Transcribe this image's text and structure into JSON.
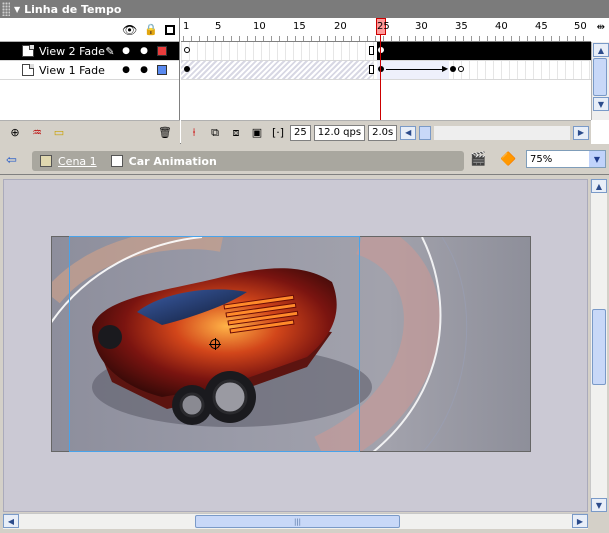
{
  "panel": {
    "title": "Linha de Tempo"
  },
  "layers": [
    {
      "name": "View 2 Fade",
      "selected": true,
      "color": "#e83c3c"
    },
    {
      "name": "View 1 Fade",
      "selected": false,
      "color": "#5a8af0"
    }
  ],
  "ruler": {
    "marks": [
      "1",
      "5",
      "10",
      "15",
      "20",
      "25",
      "30",
      "35",
      "40",
      "45",
      "50"
    ]
  },
  "status": {
    "current_frame": "25",
    "fps": "12.0 qps",
    "elapsed": "2.0s"
  },
  "editbar": {
    "scene": "Cena 1",
    "symbol": "Car Animation",
    "zoom": "75%"
  },
  "colors": {
    "header_bg": "#7b7b7b",
    "playhead": "#cc0000",
    "selection": "#49a3ea"
  }
}
